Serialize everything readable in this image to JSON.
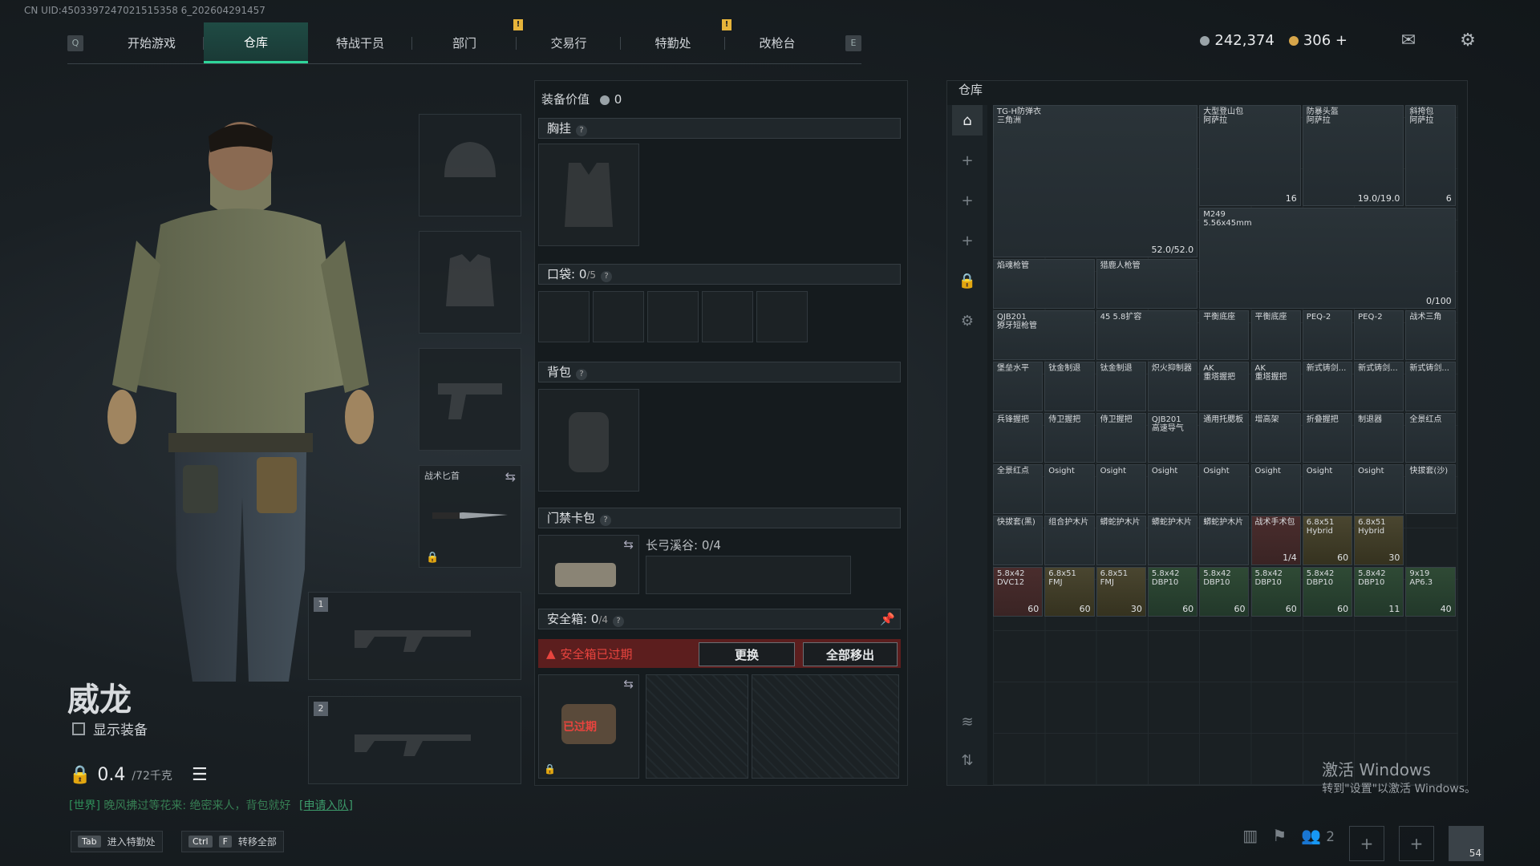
{
  "uid": "CN UID:4503397247021515358 6_202604291457",
  "nav": {
    "left_key": "Q",
    "right_key": "E",
    "tabs": [
      "开始游戏",
      "仓库",
      "特战干员",
      "部门",
      "交易行",
      "特勤处",
      "改枪台"
    ],
    "active_tab": 1
  },
  "currency": {
    "silver": "242,374",
    "gold": "306 +"
  },
  "operator": {
    "name": "威龙",
    "show_equipment": "显示装备",
    "weight": "0.4",
    "weight_max": "/72千克"
  },
  "chat": {
    "channel": "[世界]",
    "message": "晚风拂过等花来: 绝密来人，背包就好",
    "link": "[申请入队]"
  },
  "hints": {
    "tab_key": "Tab",
    "tab_label": "进入特勤处",
    "ctrl_key": "Ctrl",
    "f_key": "F",
    "transfer_label": "转移全部"
  },
  "slots": {
    "melee_label": "战术匕首",
    "weapon1": "1",
    "weapon2": "2"
  },
  "loadout": {
    "title": "装备价值",
    "value": "0",
    "chest_rig": "胸挂",
    "pocket": "口袋:",
    "pocket_count": "0",
    "pocket_max": "/5",
    "backpack": "背包",
    "keycard": "门禁卡包",
    "keycard_sub": "长弓溪谷: 0/4",
    "safe_box": "安全箱:",
    "safe_count": "0",
    "safe_max": "/4",
    "safe_expired": "安全箱已过期",
    "replace_btn": "更换",
    "remove_all_btn": "全部移出",
    "expired_label": "已过期"
  },
  "warehouse": {
    "title": "仓库",
    "items": [
      {
        "name": "TG-H防弹衣\n三角洲",
        "count": "52.0/52.0"
      },
      {
        "name": "大型登山包\n阿萨拉",
        "count": "16"
      },
      {
        "name": "防暴头盔\n阿萨拉",
        "count": "19.0/19.0"
      },
      {
        "name": "斜挎包\n阿萨拉",
        "count": "6"
      },
      {
        "name": "M249\n5.56x45mm",
        "count": "0/100"
      },
      {
        "name": "焰魂枪管",
        "count": ""
      },
      {
        "name": "猎鹿人枪管",
        "count": ""
      },
      {
        "name": "QJB201\n獠牙短枪管",
        "count": ""
      },
      {
        "name": "45 5.8扩容",
        "count": ""
      },
      {
        "name": "平衡底座",
        "count": ""
      },
      {
        "name": "平衡底座",
        "count": ""
      },
      {
        "name": "PEQ-2",
        "count": ""
      },
      {
        "name": "PEQ-2",
        "count": ""
      },
      {
        "name": "战术三角",
        "count": ""
      },
      {
        "name": "堡垒水平",
        "count": ""
      },
      {
        "name": "钛金制退",
        "count": ""
      },
      {
        "name": "钛金制退",
        "count": ""
      },
      {
        "name": "炽火抑制器",
        "count": ""
      },
      {
        "name": "AK\n重塔握把",
        "count": ""
      },
      {
        "name": "AK\n重塔握把",
        "count": ""
      },
      {
        "name": "新式铸剑...",
        "count": ""
      },
      {
        "name": "新式铸剑...",
        "count": ""
      },
      {
        "name": "新式铸剑...",
        "count": ""
      },
      {
        "name": "兵锋握把",
        "count": ""
      },
      {
        "name": "侍卫握把",
        "count": ""
      },
      {
        "name": "侍卫握把",
        "count": ""
      },
      {
        "name": "QJB201\n高速导气",
        "count": ""
      },
      {
        "name": "通用托腮板",
        "count": ""
      },
      {
        "name": "增高架",
        "count": ""
      },
      {
        "name": "折叠握把",
        "count": ""
      },
      {
        "name": "制退器",
        "count": ""
      },
      {
        "name": "全景红点",
        "count": ""
      },
      {
        "name": "全景红点",
        "count": ""
      },
      {
        "name": "Osight",
        "count": ""
      },
      {
        "name": "Osight",
        "count": ""
      },
      {
        "name": "Osight",
        "count": ""
      },
      {
        "name": "Osight",
        "count": ""
      },
      {
        "name": "Osight",
        "count": ""
      },
      {
        "name": "Osight",
        "count": ""
      },
      {
        "name": "Osight",
        "count": ""
      },
      {
        "name": "快拔套(沙)",
        "count": ""
      },
      {
        "name": "快拔套(黑)",
        "count": ""
      },
      {
        "name": "组合护木片",
        "count": ""
      },
      {
        "name": "蟒蛇护木片",
        "count": ""
      },
      {
        "name": "蟒蛇护木片",
        "count": ""
      },
      {
        "name": "蟒蛇护木片",
        "count": ""
      },
      {
        "name": "战术手术包",
        "count": "1/4"
      },
      {
        "name": "6.8x51\nHybrid",
        "count": "60"
      },
      {
        "name": "6.8x51\nHybrid",
        "count": "30"
      },
      {
        "name": "5.8x42\nDVC12",
        "count": "60"
      },
      {
        "name": "6.8x51\nFMJ",
        "count": "60"
      },
      {
        "name": "6.8x51\nFMJ",
        "count": "30"
      },
      {
        "name": "5.8x42\nDBP10",
        "count": "60"
      },
      {
        "name": "5.8x42\nDBP10",
        "count": "60"
      },
      {
        "name": "5.8x42\nDBP10",
        "count": "60"
      },
      {
        "name": "5.8x42\nDBP10",
        "count": "60"
      },
      {
        "name": "5.8x42\nDBP10",
        "count": "11"
      },
      {
        "name": "9x19\nAP6.3",
        "count": "40"
      }
    ]
  },
  "windows": {
    "line1": "激活 Windows",
    "line2": "转到\"设置\"以激活 Windows。"
  },
  "bottom": {
    "squad_count": "2",
    "level": "54"
  },
  "colors": {
    "accent": "#2fd69a",
    "warning": "#e7b43a",
    "danger": "#e8443e"
  }
}
